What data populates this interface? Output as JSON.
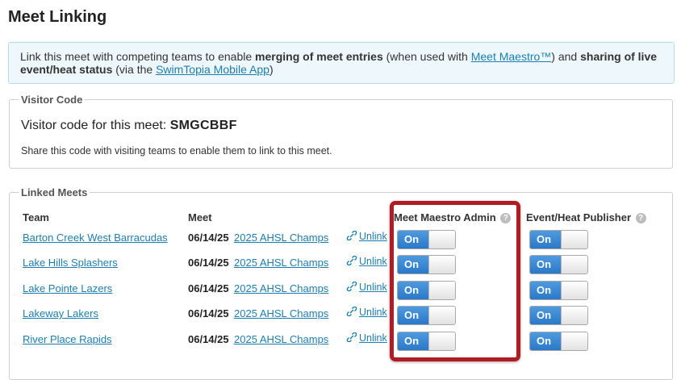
{
  "page": {
    "title": "Meet Linking"
  },
  "info": {
    "text_1": "Link this meet with competing teams to enable ",
    "bold_1": "merging of meet entries",
    "text_2": " (when used with ",
    "link_1": "Meet Maestro™",
    "text_3": ") and ",
    "bold_2": "sharing of live event/heat status",
    "text_4": " (via the ",
    "link_2": "SwimTopia Mobile App",
    "text_5": ")"
  },
  "visitor": {
    "legend": "Visitor Code",
    "label": "Visitor code for this meet:",
    "code": "SMGCBBF",
    "description": "Share this code with visiting teams to enable them to link to this meet."
  },
  "linked": {
    "legend": "Linked Meets",
    "headers": {
      "team": "Team",
      "meet": "Meet",
      "mm_admin": "Meet Maestro Admin",
      "publisher": "Event/Heat Publisher",
      "help_glyph": "?"
    },
    "unlink_label": "Unlink",
    "rows": [
      {
        "team": "Barton Creek West Barracudas",
        "date": "06/14/25",
        "meet": "2025 AHSL Champs",
        "mm_admin": "On",
        "publisher": "On"
      },
      {
        "team": "Lake Hills Splashers",
        "date": "06/14/25",
        "meet": "2025 AHSL Champs",
        "mm_admin": "On",
        "publisher": "On"
      },
      {
        "team": "Lake Pointe Lazers",
        "date": "06/14/25",
        "meet": "2025 AHSL Champs",
        "mm_admin": "On",
        "publisher": "On"
      },
      {
        "team": "Lakeway Lakers",
        "date": "06/14/25",
        "meet": "2025 AHSL Champs",
        "mm_admin": "On",
        "publisher": "On"
      },
      {
        "team": "River Place Rapids",
        "date": "06/14/25",
        "meet": "2025 AHSL Champs",
        "mm_admin": "On",
        "publisher": "On"
      }
    ]
  },
  "colors": {
    "link": "#1a7fb5",
    "toggle_on": "#2a78c8",
    "highlight": "#b01c24",
    "info_bg": "#eef7fc"
  },
  "icons": {
    "unlink": "chain-link-icon",
    "help": "question-circle-icon"
  }
}
